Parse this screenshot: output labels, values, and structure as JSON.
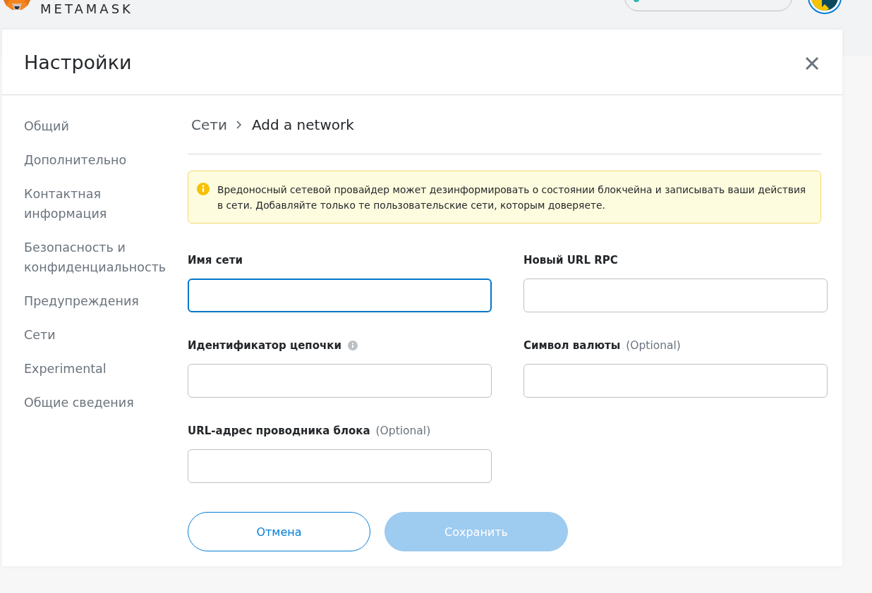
{
  "header": {
    "wordmark": "METAMASK"
  },
  "settings": {
    "title": "Настройки",
    "sidebar": {
      "items": [
        {
          "label": "Общий",
          "selected": false
        },
        {
          "label": "Дополнительно",
          "selected": false
        },
        {
          "label": "Контактная информация",
          "selected": false
        },
        {
          "label": "Безопасность и конфиденциальность",
          "selected": false
        },
        {
          "label": "Предупреждения",
          "selected": false
        },
        {
          "label": "Сети",
          "selected": false
        },
        {
          "label": "Experimental",
          "selected": false
        },
        {
          "label": "Общие сведения",
          "selected": false
        }
      ]
    },
    "breadcrumb": {
      "parent": "Сети",
      "current": "Add a network"
    },
    "warning": {
      "text": "Вредоносный сетевой провайдер может дезинформировать о состоянии блокчейна и записывать ваши действия в сети. Добавляйте только те пользовательские сети, которым доверяете."
    },
    "fields": [
      {
        "label": "Имя сети",
        "info": false,
        "focused": true
      },
      {
        "label": "Новый URL RPC",
        "info": false,
        "focused": false
      },
      {
        "label": "Идентификатор цепочки",
        "info": true,
        "focused": false
      },
      {
        "label": "Символ валюты",
        "optional": "(Optional)",
        "info": false,
        "focused": false
      },
      {
        "label": "URL-адрес проводника блока",
        "optional": "(Optional)",
        "info": false,
        "focused": false
      }
    ],
    "buttons": [
      {
        "label": "Отмена",
        "kind": "secondary",
        "disabled": false
      },
      {
        "label": "Сохранить",
        "kind": "primary",
        "disabled": true
      }
    ]
  }
}
